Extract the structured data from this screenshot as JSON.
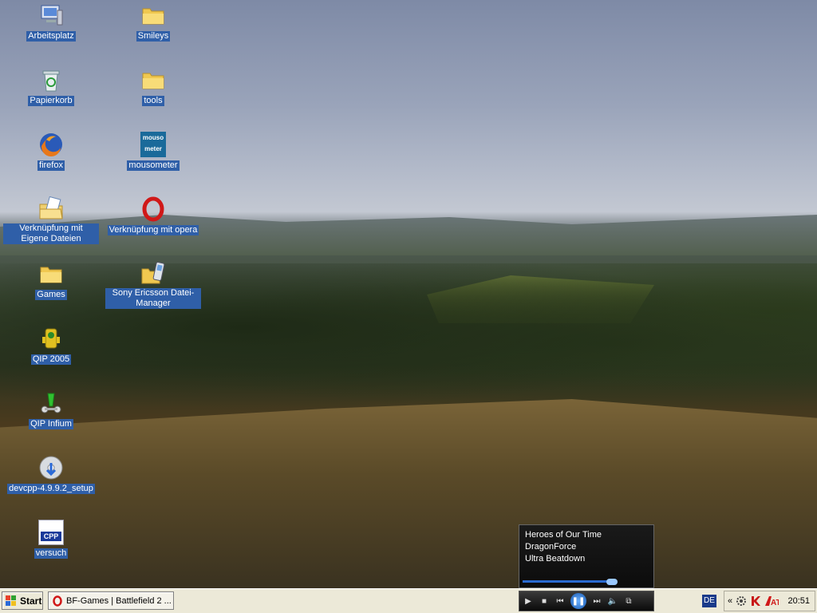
{
  "desktop": {
    "icons": [
      {
        "label": "Arbeitsplatz",
        "icon": "computer-icon"
      },
      {
        "label": "Smileys",
        "icon": "folder-icon"
      },
      {
        "label": "Papierkorb",
        "icon": "recycle-bin-icon"
      },
      {
        "label": "tools",
        "icon": "folder-icon"
      },
      {
        "label": "firefox",
        "icon": "firefox-icon"
      },
      {
        "label": "mousometer",
        "icon": "mousometer-icon",
        "icon_text": "mouso meter"
      },
      {
        "label": "Verknüpfung mit Eigene Dateien",
        "icon": "my-documents-icon"
      },
      {
        "label": "Verknüpfung mit opera",
        "icon": "opera-icon"
      },
      {
        "label": "Games",
        "icon": "folder-icon"
      },
      {
        "label": "Sony Ericsson Datei-Manager",
        "icon": "phone-folder-icon"
      },
      {
        "label": "QIP 2005",
        "icon": "qip-icon"
      },
      {
        "label": "QIP Infium",
        "icon": "qip-infium-icon"
      },
      {
        "label": "devcpp-4.9.9.2_setup",
        "icon": "setup-disc-icon"
      },
      {
        "label": "versuch",
        "icon": "cpp-file-icon",
        "icon_text": "CPP"
      }
    ]
  },
  "media_popup": {
    "title": "Heroes of Our Time",
    "artist": "DragonForce",
    "album": "Ultra Beatdown",
    "progress": 0.93
  },
  "taskbar": {
    "start_label": "Start",
    "tasks": [
      {
        "label": "BF-Games | Battlefield 2 ...",
        "icon": "opera-icon"
      }
    ],
    "language": "DE",
    "clock": "20:51",
    "tray_expand": "«"
  },
  "colors": {
    "label_highlight": "#2f5fa8",
    "taskbar": "#ece9d8"
  }
}
